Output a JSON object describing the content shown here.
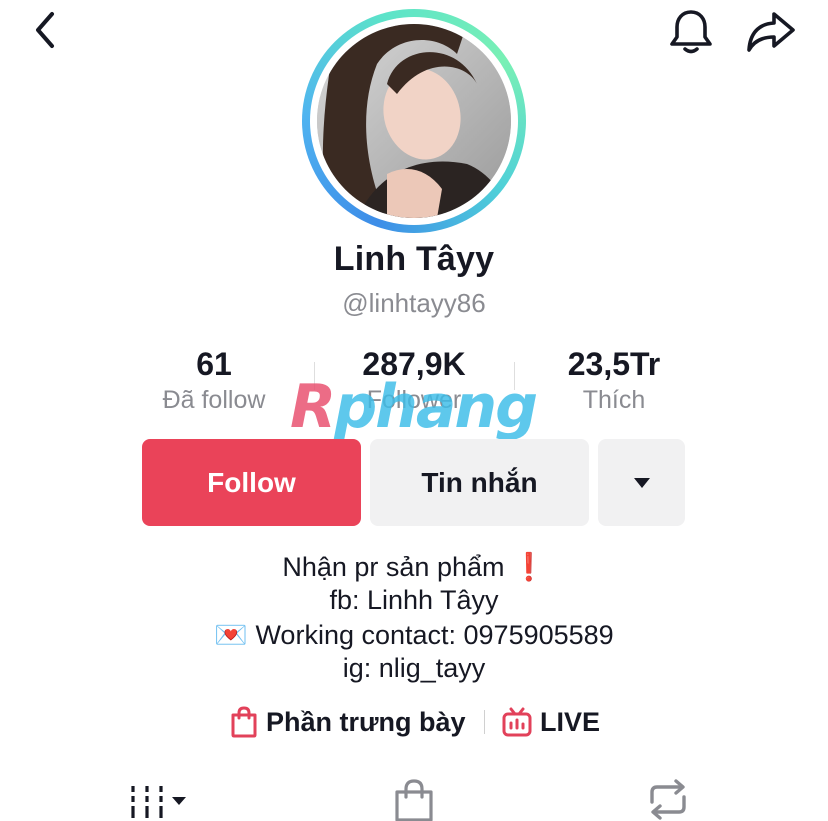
{
  "profile": {
    "display_name": "Linh Tâyy",
    "username": "@linhtayy86"
  },
  "stats": [
    {
      "value": "61",
      "label": "Đã follow"
    },
    {
      "value": "287,9K",
      "label": "Follower"
    },
    {
      "value": "23,5Tr",
      "label": "Thích"
    }
  ],
  "watermark": {
    "first": "R",
    "rest": "phang"
  },
  "actions": {
    "follow_label": "Follow",
    "message_label": "Tin nhắn"
  },
  "bio": {
    "line1": "Nhận pr sản phẩm",
    "line1_emoji": "❗",
    "line2": "fb: Linhh Tâyy",
    "line3_emoji": "💌",
    "line3": "Working contact: 0975905589",
    "line4": "ig: nlig_tayy"
  },
  "links": {
    "showcase_label": "Phần trưng bày",
    "live_label": "LIVE"
  },
  "colors": {
    "accent": "#ea4359",
    "secondary_button": "#f1f1f2",
    "muted_text": "#8a8b91",
    "avatar_ring_start": "#3d8de8",
    "avatar_ring_end": "#79f0b5"
  },
  "icons": {
    "back": "chevron-left-icon",
    "notifications": "bell-icon",
    "share": "share-arrow-icon",
    "more": "caret-down-icon",
    "showcase": "shopping-bag-icon",
    "live": "live-tv-icon",
    "tab_videos": "grid-icon",
    "tab_shop": "shopping-bag-icon",
    "tab_repost": "repost-icon"
  }
}
